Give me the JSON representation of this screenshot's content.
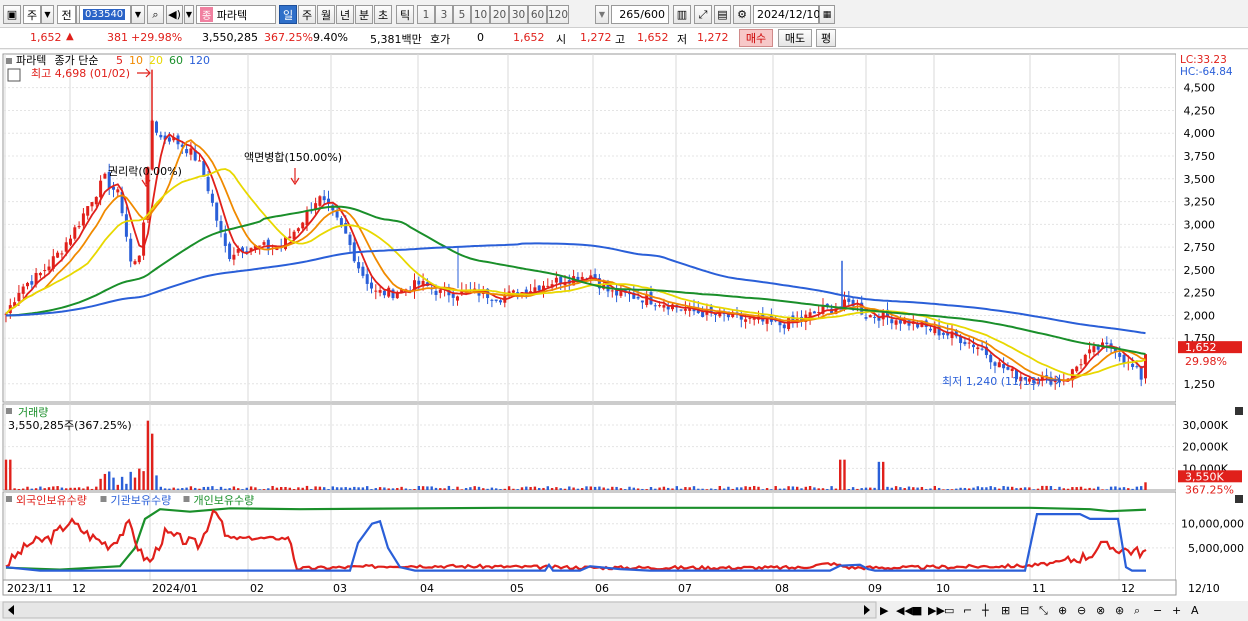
{
  "toolbar": {
    "market": "주",
    "scope": "전",
    "code": "033540",
    "name": "파라텍",
    "periods": [
      "일",
      "주",
      "월",
      "년",
      "분",
      "초",
      "틱"
    ],
    "active_period": "일",
    "intervals": [
      "1",
      "3",
      "5",
      "10",
      "20",
      "30",
      "60",
      "120"
    ],
    "count": "265",
    "count_total": "/600",
    "date": "2024/12/10"
  },
  "quote": {
    "price": "1,652",
    "change": "381",
    "change_pct": "+29.98%",
    "volume": "3,550,285",
    "volume_pct": "367.25%",
    "turnover_pct": "9.40%",
    "amount": "5,381백만",
    "bid_label": "호가",
    "bid_value": "0",
    "bid_price": "1,652",
    "open_label": "시",
    "open": "1,272",
    "high_label": "고",
    "high": "1,652",
    "low_label": "저",
    "low": "1,272",
    "buy_label": "매수",
    "sell_label": "매도",
    "eval_label": "평"
  },
  "price_panel": {
    "legend": [
      {
        "text": "파라텍",
        "color": "#000000"
      },
      {
        "text": "종가 단순",
        "color": "#000000"
      },
      {
        "text": "5",
        "color": "#e0201b"
      },
      {
        "text": "10",
        "color": "#f08a00"
      },
      {
        "text": "20",
        "color": "#e8d800"
      },
      {
        "text": "60",
        "color": "#1a8f2a"
      },
      {
        "text": "120",
        "color": "#2a5fd8"
      }
    ],
    "high_note": "최고 4,698 (01/02)",
    "low_note": "최저 1,240 (11/13)",
    "event1": "권리락(0.00%)",
    "event2": "액면병합(150.00%)",
    "lc": "LC:33.23",
    "hc": "HC:-64.84",
    "current_price": "1,652",
    "current_pct": "29.98%",
    "y_ticks": [
      "4,500",
      "4,250",
      "4,000",
      "3,750",
      "3,500",
      "3,250",
      "3,000",
      "2,750",
      "2,500",
      "2,250",
      "2,000",
      "1,750",
      "1,250"
    ]
  },
  "volume_panel": {
    "title": "거래량",
    "note": "3,550,285주(367.25%)",
    "y_ticks": [
      "30,000K",
      "20,000K",
      "10,000K"
    ],
    "current": "3,550K",
    "current_pct": "367.25%"
  },
  "holding_panel": {
    "legend": [
      {
        "text": "외국인보유수량",
        "color": "#e0201b"
      },
      {
        "text": "기관보유수량",
        "color": "#2a5fd8"
      },
      {
        "text": "개인보유수량",
        "color": "#1a8f2a"
      }
    ],
    "y_ticks": [
      "10,000,000",
      "5,000,000"
    ]
  },
  "x_axis": {
    "labels": [
      "2023/11",
      "12",
      "2024/01",
      "02",
      "03",
      "04",
      "05",
      "06",
      "07",
      "08",
      "09",
      "10",
      "11",
      "12"
    ],
    "right_label": "12/10"
  },
  "colors": {
    "up": "#e0201b",
    "down": "#2a5fd8",
    "ma5": "#e0201b",
    "ma10": "#f08a00",
    "ma20": "#e8d800",
    "ma60": "#1a8f2a",
    "ma120": "#2a5fd8"
  }
}
